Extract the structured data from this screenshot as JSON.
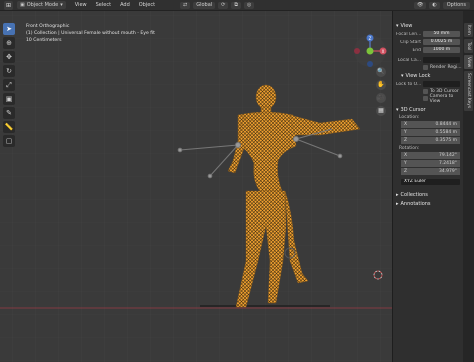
{
  "header": {
    "mode": "Object Mode",
    "menus": [
      "View",
      "Select",
      "Add",
      "Object"
    ],
    "transform_orientation": "Global",
    "options_label": "Options"
  },
  "viewport": {
    "view_name": "Front Orthographic",
    "collection": "(1) Collection | Universal Female without mouth - Eye fit",
    "scale": "10 Centimeters"
  },
  "gizmo": {
    "z_label": "Z",
    "x_label": "X"
  },
  "npanel": {
    "view_section": "View",
    "focal_length_label": "Focal Len...",
    "focal_length": "50 mm",
    "clip_start_label": "Clip Start",
    "clip_start": "0.0025 m",
    "clip_end_label": "End",
    "clip_end": "1000 m",
    "local_camera_label": "Local Ca...",
    "render_region_label": "Render Regi...",
    "view_lock_section": "View Lock",
    "lock_to_object_label": "Lock to O...",
    "lock_to_3d_cursor_label": "To 3D Cursor",
    "camera_to_view_label": "Camera to View",
    "cursor_section": "3D Cursor",
    "location_label": "Location:",
    "location": [
      {
        "axis": "X",
        "value": "0.8444 m"
      },
      {
        "axis": "Y",
        "value": "0.5584 m"
      },
      {
        "axis": "Z",
        "value": "0.3575 m"
      }
    ],
    "rotation_label": "Rotation:",
    "rotation": [
      {
        "axis": "X",
        "value": "79.142°"
      },
      {
        "axis": "Y",
        "value": "7.2418°"
      },
      {
        "axis": "Z",
        "value": "34.979°"
      }
    ],
    "rotation_mode": "XYZ Euler",
    "collections_section": "Collections",
    "annotations_section": "Annotations"
  },
  "sidetabs": [
    "Item",
    "Tool",
    "View",
    "Screencast Keys"
  ],
  "colors": {
    "accent": "#4772b3",
    "selection_orange": "#f0a030",
    "viewport_bg": "#3a3a3a"
  }
}
